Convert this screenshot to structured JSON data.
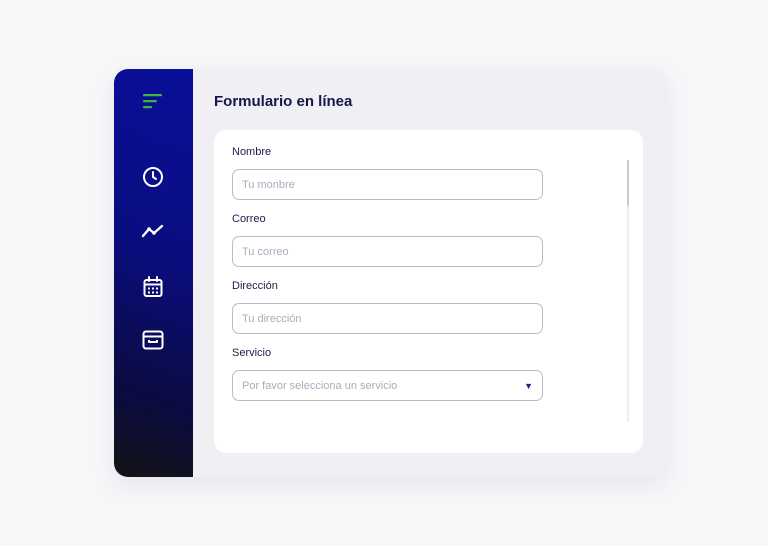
{
  "colors": {
    "sidebar_top": "#0a0f9a",
    "sidebar_bottom": "#131316",
    "menu_accent": "#39b54a",
    "title": "#15174a",
    "caret": "#1a2a8c"
  },
  "sidebar": {
    "icons": [
      "menu-icon",
      "clock-icon",
      "trend-icon",
      "calendar-icon",
      "archive-icon"
    ]
  },
  "form": {
    "title": "Formulario en línea",
    "name": {
      "label": "Nombre",
      "placeholder": "Tu monbre"
    },
    "email": {
      "label": "Correo",
      "placeholder": "Tu correo"
    },
    "address": {
      "label": "Dirección",
      "placeholder": "Tu dirección"
    },
    "service": {
      "label": "Servicio",
      "placeholder": "Por favor selecciona un servicio"
    }
  }
}
